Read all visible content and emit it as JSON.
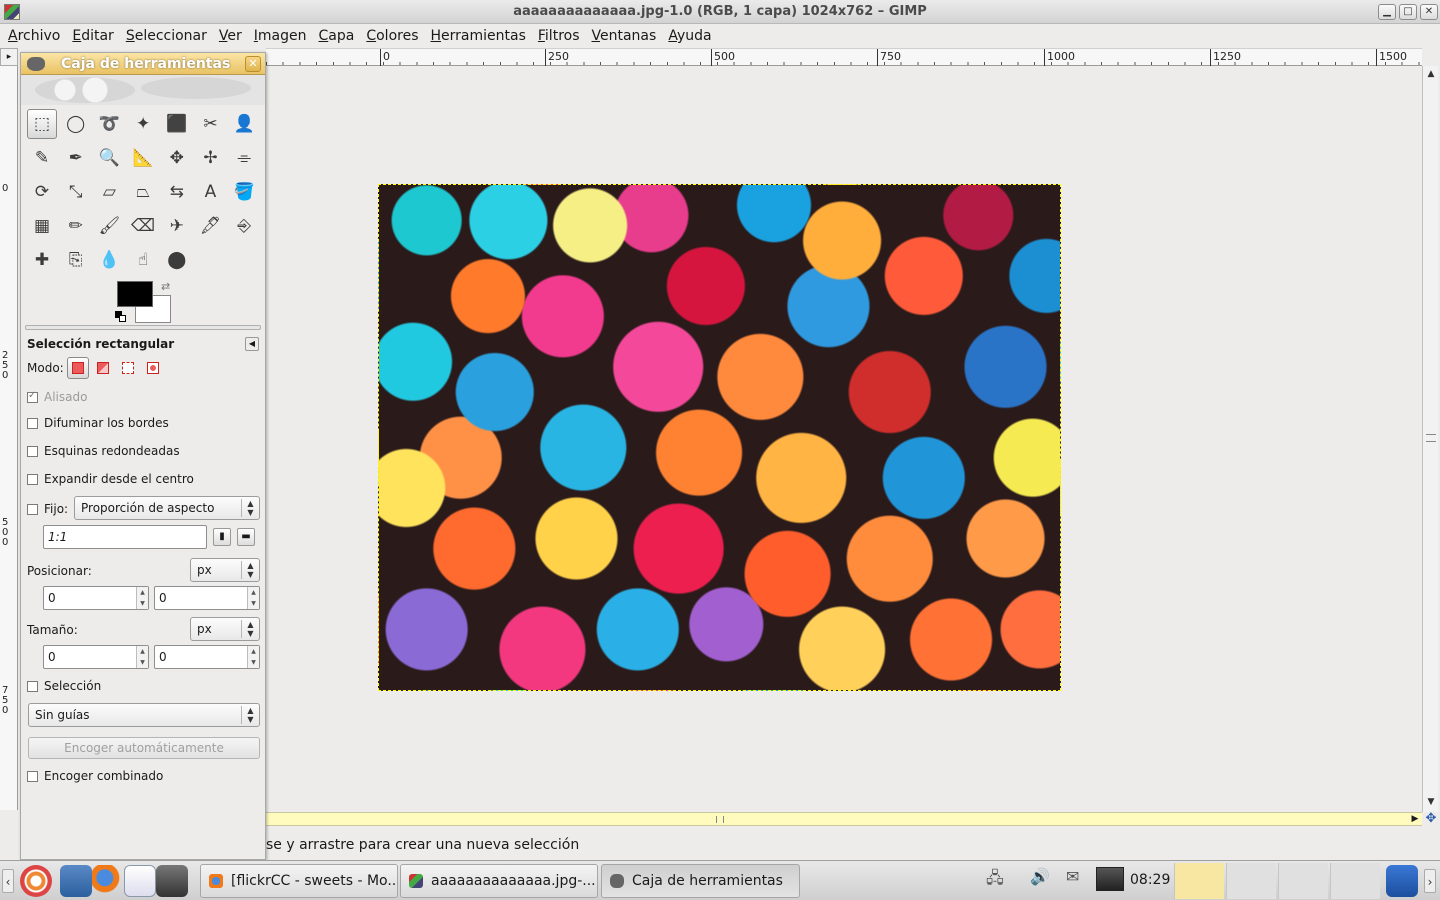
{
  "window": {
    "title": "aaaaaaaaaaaaaa.jpg-1.0 (RGB, 1 capa) 1024x762 – GIMP",
    "min": "▁",
    "max": "□",
    "close": "✕"
  },
  "menubar": [
    "Archivo",
    "Editar",
    "Seleccionar",
    "Ver",
    "Imagen",
    "Capa",
    "Colores",
    "Herramientas",
    "Filtros",
    "Ventanas",
    "Ayuda"
  ],
  "ruler": {
    "h_ticks": [
      "0",
      "250",
      "500",
      "750",
      "1000",
      "1250",
      "1500"
    ],
    "v_ticks": [
      "0",
      "250",
      "500",
      "750"
    ]
  },
  "toolbox": {
    "title": "Caja de herramientas",
    "tools": [
      "rect-select",
      "ellipse-select",
      "free-select",
      "fuzzy-select",
      "color-select",
      "scissors-select",
      "foreground-select",
      "paths",
      "color-picker",
      "zoom",
      "measure",
      "move",
      "align",
      "crop",
      "rotate",
      "scale",
      "shear",
      "perspective",
      "flip",
      "text",
      "bucket-fill",
      "blend",
      "pencil",
      "paintbrush",
      "eraser",
      "airbrush",
      "ink",
      "clone",
      "heal",
      "perspective-clone",
      "blur",
      "smudge",
      "dodge-burn"
    ],
    "tool_glyphs": [
      "⬚",
      "◯",
      "➰",
      "✦",
      "⬛",
      "✂",
      "👤",
      "✎",
      "✒",
      "🔍",
      "📐",
      "✥",
      "✢",
      "⌯",
      "⟳",
      "⤡",
      "▱",
      "⏢",
      "⇆",
      "A",
      "🪣",
      "▦",
      "✏",
      "🖌",
      "⌫",
      "✈",
      "🖋",
      "⎆",
      "✚",
      "⎘",
      "💧",
      "☝",
      "⬤"
    ]
  },
  "tool_options": {
    "title": "Selección rectangular",
    "mode_label": "Modo:",
    "antialias": "Alisado",
    "feather": "Difuminar los bordes",
    "rounded": "Esquinas redondeadas",
    "expand_center": "Expandir desde el centro",
    "fixed_label": "Fijo:",
    "fixed_value": "Proporción de aspecto",
    "ratio_value": "1:1",
    "position_label": "Posicionar:",
    "position_unit": "px",
    "pos_x": "0",
    "pos_y": "0",
    "size_label": "Tamaño:",
    "size_unit": "px",
    "size_w": "0",
    "size_h": "0",
    "highlight": "Selección",
    "guides": "Sin guías",
    "autoshrink": "Encoger automáticamente",
    "shrink_merged": "Encoger combinado"
  },
  "statusbar": {
    "message": "se y arrastre para crear una nueva selección"
  },
  "taskbar": {
    "tasks": [
      "[flickrCC - sweets - Mo...",
      "aaaaaaaaaaaaaa.jpg-...",
      "Caja de herramientas"
    ],
    "clock": "08:29"
  }
}
